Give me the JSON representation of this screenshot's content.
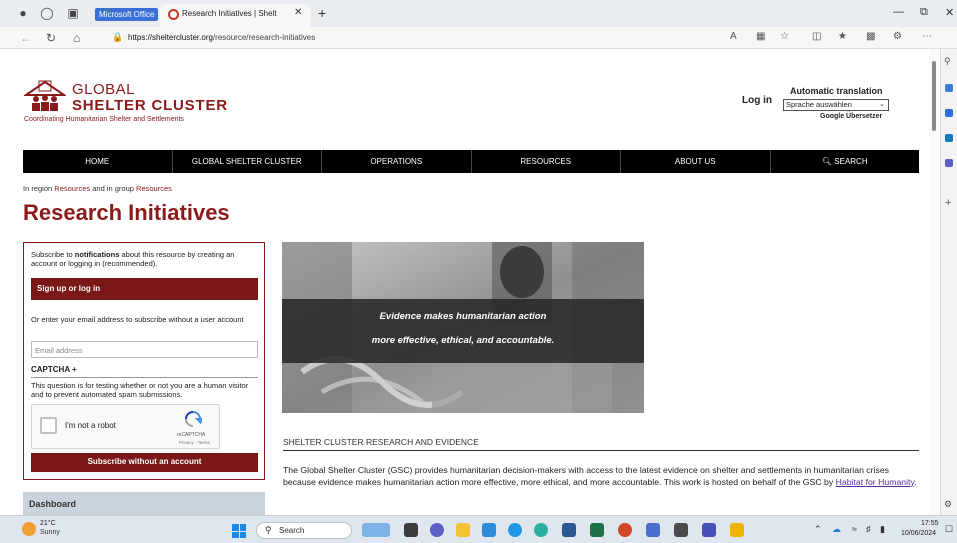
{
  "browser": {
    "badge": "Microsoft Office",
    "tab_title": "Research Initiatives | Shelter Clus",
    "url_host": "https://sheltercluster.org",
    "url_path": "/resource/research-initiatives"
  },
  "site": {
    "logo_line1": "GLOBAL",
    "logo_line2": "SHELTER CLUSTER",
    "logo_tagline": "Coordinating Humanitarian Shelter and Settlements",
    "login": "Log in",
    "auto_translation": "Automatic translation",
    "language_select": "Sprache auswählen",
    "google_translate": "Google Übersetzer"
  },
  "nav": [
    "HOME",
    "GLOBAL SHELTER CLUSTER",
    "OPERATIONS",
    "RESOURCES",
    "ABOUT US",
    "SEARCH"
  ],
  "breadcrumb": {
    "prefix": "In region",
    "region": "Resources",
    "middle": "and in group",
    "group": "Resources"
  },
  "page_title": "Research Initiatives",
  "subscribe": {
    "intro_pre": "Subscribe to",
    "intro_bold": "notifications",
    "intro_post": "about this resource by creating an account or logging in (recommended).",
    "signup": "Sign up or log in",
    "email_intro": "Or enter your email address to subscribe without a user account",
    "email_placeholder": "Email address",
    "captcha_heading": "CAPTCHA +",
    "captcha_desc": "This question is for testing whether or not you are a human visitor and to prevent automated spam submissions.",
    "robot_label": "I'm not a robot",
    "recaptcha_brand": "reCAPTCHA",
    "recaptcha_terms": "Privacy - Terms",
    "submit": "Subscribe without an account"
  },
  "dashboard": "Dashboard",
  "hero": {
    "line1": "Evidence makes humanitarian action",
    "line2": "more effective, ethical, and accountable."
  },
  "section_heading": "SHELTER CLUSTER RESEARCH AND EVIDENCE",
  "body": {
    "text": "The Global Shelter Cluster (GSC) provides humanitarian decision-makers with access to the latest evidence on shelter and settlements in humanitarian crises because evidence makes humanitarian action more effective, more ethical, and more accountable. This work is hosted on behalf of the GSC by",
    "link": "Habitat for Humanity",
    "end": "."
  },
  "taskbar": {
    "temp": "21°C",
    "condition": "Sunny",
    "search": "Search",
    "time": "17:55",
    "date": "10/06/2024"
  }
}
